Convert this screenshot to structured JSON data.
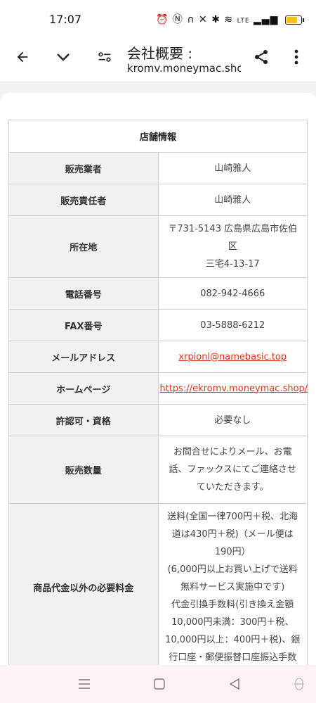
{
  "status_bar": {
    "time": "17:07",
    "icons": [
      "alarm-icon",
      "nfc-icon",
      "headset-icon",
      "mute-icon",
      "bluetooth-icon",
      "wifi-icon",
      "volte-icon",
      "signal-icon",
      "battery-icon"
    ],
    "battery_color": "#f6c21c"
  },
  "toolbar": {
    "title": "会社概要 :",
    "url": "kromv.moneymac.shop"
  },
  "table": {
    "header": "店舗情報",
    "rows": [
      {
        "key": "販売業者",
        "value": "山崎雅人"
      },
      {
        "key": "販売責任者",
        "value": "山崎雅人"
      },
      {
        "key": "所在地",
        "value": "〒731-5143 広島県広島市佐伯区\n三宅4-13-17"
      },
      {
        "key": "電話番号",
        "value": "082-942-4666"
      },
      {
        "key": "FAX番号",
        "value": "03-5888-6212"
      },
      {
        "key": "メールアドレス",
        "value": "xrpionl@namebasic.top"
      },
      {
        "key": "ホームページ",
        "value": "https://ekromv.moneymac.shop/"
      },
      {
        "key": "許認可・資格",
        "value": "必要なし"
      },
      {
        "key": "販売数量",
        "value": "お問合せによりメール、お電\n話、ファックスにてご連絡させ\nていただきます。"
      },
      {
        "key": "商品代金以外の必要料金",
        "value": "送料(全国一律700円＋税、北海\n道は430円＋税)（メール便は\n190円）\n(6,000円以上お買い上げで送料\n無料サービス実施中です)\n代金引換手数料(引き換え金額\n10,000円未満：300円＋税、\n10,000円以上：400円＋税)、銀\n行口座・郵便振替口座振込手数"
      }
    ],
    "link_color": "#e0341c"
  },
  "colors": {
    "key_cell_bg": "#f1f1f1",
    "border": "#cfcfcf",
    "nav_bg": "#fdf2f2"
  }
}
